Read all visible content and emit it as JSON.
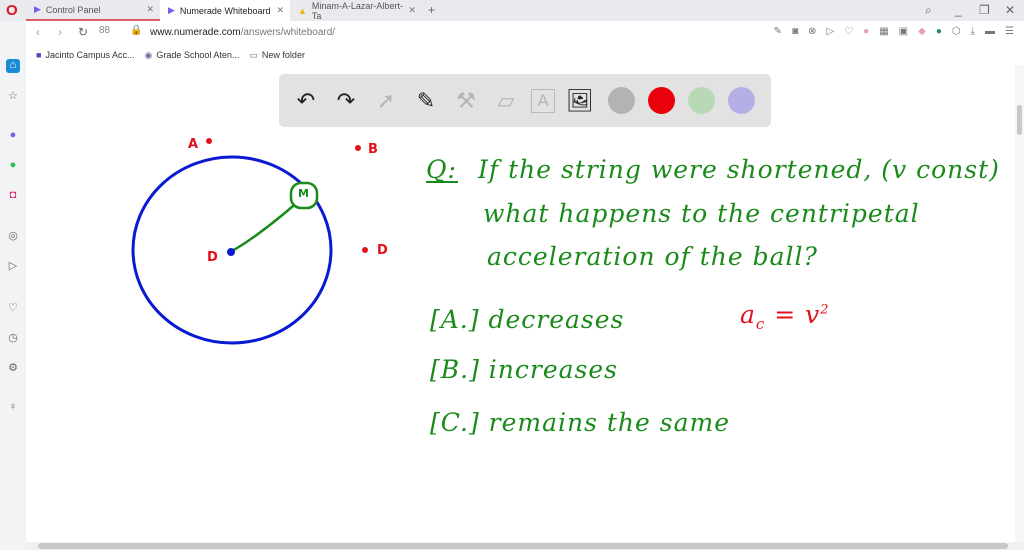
{
  "browser": {
    "tabs": [
      {
        "label": "Control Panel",
        "active": false
      },
      {
        "label": "Numerade Whiteboard",
        "active": true
      },
      {
        "label": "Minam-A-Lazar-Albert-Ta",
        "active": false
      }
    ],
    "new_tab": "+",
    "url_domain": "www.numerade.com",
    "url_path": "/answers/whiteboard/",
    "bookmarks": [
      "Jacinto Campus Acc...",
      "Grade School Aten...",
      "New folder"
    ]
  },
  "toolbar": {
    "colors": [
      "#b3b3b3",
      "#e8000b",
      "#b9d8b5",
      "#b4b0e6"
    ]
  },
  "whiteboard": {
    "points": {
      "A": "A",
      "B": "B",
      "D1": "D",
      "D2": "D",
      "M": "M"
    },
    "question": [
      "Q:",
      "If the string were shortened, (v const)",
      "what happens to the centripetal",
      "acceleration of the ball?"
    ],
    "options": [
      "[A.] decreases",
      "[B.] increases",
      "[C.] remains the same"
    ],
    "formula": {
      "lhs": "a",
      "sub": "c",
      "rhs": "= v",
      "sup": "2"
    }
  }
}
